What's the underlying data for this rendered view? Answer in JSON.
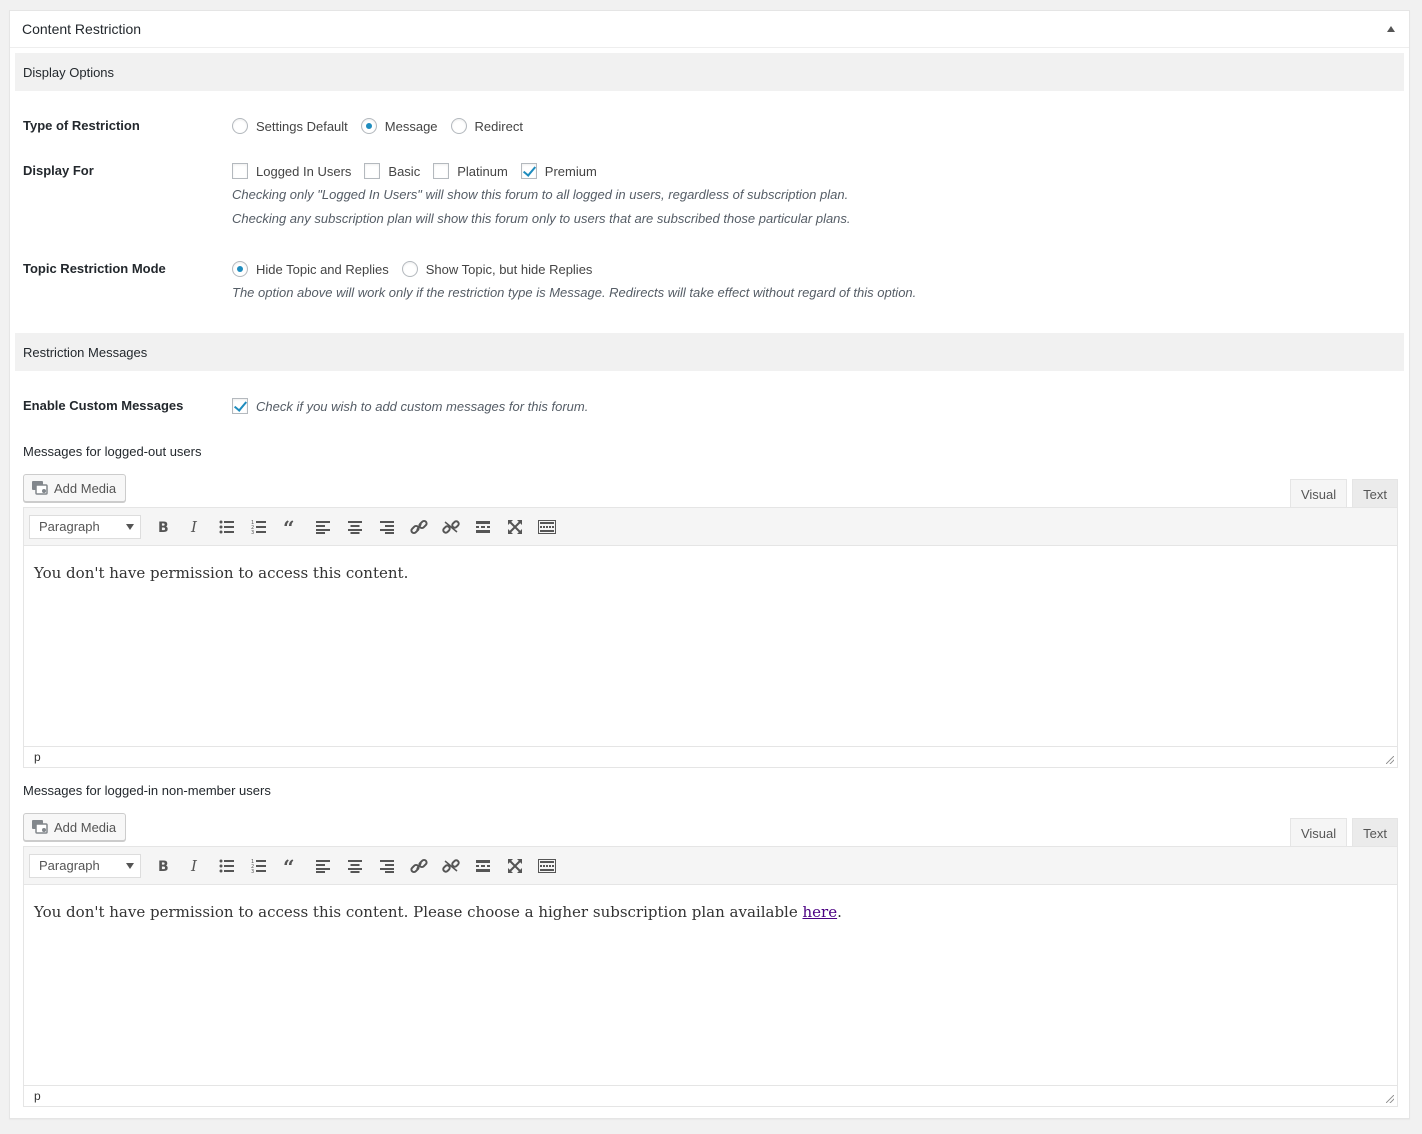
{
  "postbox": {
    "title": "Content Restriction"
  },
  "display_options": {
    "heading": "Display Options",
    "type_of_restriction": {
      "label": "Type of Restriction",
      "options": [
        {
          "label": "Settings Default",
          "checked": false
        },
        {
          "label": "Message",
          "checked": true
        },
        {
          "label": "Redirect",
          "checked": false
        }
      ]
    },
    "display_for": {
      "label": "Display For",
      "options": [
        {
          "label": "Logged In Users",
          "checked": false
        },
        {
          "label": "Basic",
          "checked": false
        },
        {
          "label": "Platinum",
          "checked": false
        },
        {
          "label": "Premium",
          "checked": true
        }
      ],
      "desc1": "Checking only \"Logged In Users\" will show this forum to all logged in users, regardless of subscription plan.",
      "desc2": "Checking any subscription plan will show this forum only to users that are subscribed those particular plans."
    },
    "topic_mode": {
      "label": "Topic Restriction Mode",
      "options": [
        {
          "label": "Hide Topic and Replies",
          "checked": true
        },
        {
          "label": "Show Topic, but hide Replies",
          "checked": false
        }
      ],
      "desc": "The option above will work only if the restriction type is Message. Redirects will take effect without regard of this option."
    }
  },
  "restriction_messages": {
    "heading": "Restriction Messages",
    "enable_custom": {
      "label": "Enable Custom Messages",
      "checked": true,
      "desc": "Check if you wish to add custom messages for this forum."
    },
    "editors": [
      {
        "label": "Messages for logged-out users",
        "add_media": "Add Media",
        "tab_visual": "Visual",
        "tab_text": "Text",
        "format": "Paragraph",
        "content_text": "You don't have permission to access this content.",
        "content_link": "",
        "content_after": "",
        "path": "p"
      },
      {
        "label": "Messages for logged-in non-member users",
        "add_media": "Add Media",
        "tab_visual": "Visual",
        "tab_text": "Text",
        "format": "Paragraph",
        "content_text": "You don't have permission to access this content. Please choose a higher subscription plan available ",
        "content_link": "here",
        "content_after": ".",
        "path": "p"
      }
    ]
  },
  "colors": {
    "accent": "#1e8cbe",
    "link_visited": "#4b0082",
    "section_bg": "#f1f1f1"
  }
}
